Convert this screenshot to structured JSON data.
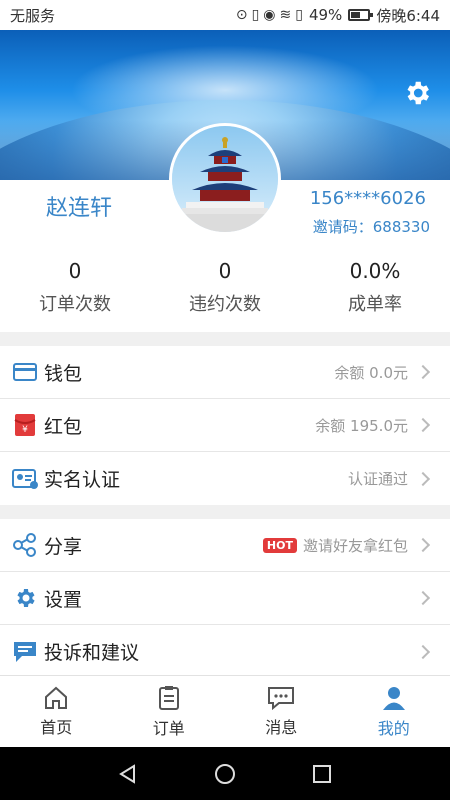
{
  "status_bar": {
    "carrier": "无服务",
    "battery": "49%",
    "time": "傍晚6:44"
  },
  "profile": {
    "name": "赵连轩",
    "phone": "156****6026",
    "invite": "邀请码：688330"
  },
  "stats": [
    {
      "value": "0",
      "label": "订单次数"
    },
    {
      "value": "0",
      "label": "违约次数"
    },
    {
      "value": "0.0%",
      "label": "成单率"
    }
  ],
  "menu_group1": [
    {
      "label": "钱包",
      "value": "余额 0.0元",
      "icon": "wallet-icon"
    },
    {
      "label": "红包",
      "value": "余额 195.0元",
      "icon": "red-packet-icon"
    },
    {
      "label": "实名认证",
      "value": "认证通过",
      "icon": "id-card-icon"
    }
  ],
  "menu_group2": [
    {
      "label": "分享",
      "badge": "HOT",
      "value": "邀请好友拿红包",
      "icon": "share-icon"
    },
    {
      "label": "设置",
      "value": "",
      "icon": "gear-icon"
    },
    {
      "label": "投诉和建议",
      "value": "",
      "icon": "feedback-icon"
    }
  ],
  "tabs": [
    {
      "label": "首页",
      "icon": "home-icon"
    },
    {
      "label": "订单",
      "icon": "clipboard-icon"
    },
    {
      "label": "消息",
      "icon": "message-icon"
    },
    {
      "label": "我的",
      "icon": "user-icon",
      "active": true
    }
  ],
  "colors": {
    "accent": "#3a86c8",
    "hot": "#e23b3b"
  }
}
